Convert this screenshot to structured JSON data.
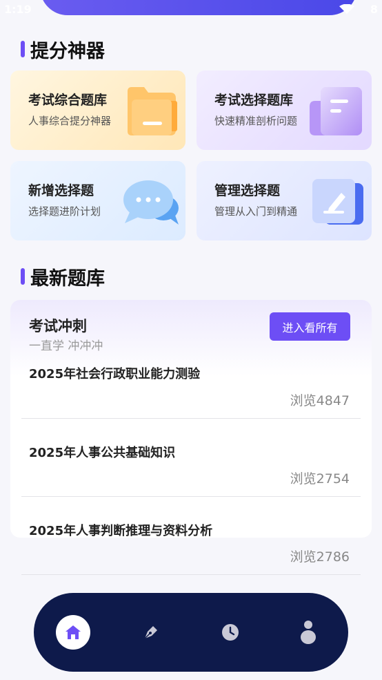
{
  "status": {
    "time": "1:19",
    "battery": "8"
  },
  "section1": {
    "title": "提分神器"
  },
  "cards": [
    {
      "title": "考试综合题库",
      "subtitle": "人事综合提分神器",
      "icon": "folder-icon",
      "accent": "#ffb84d"
    },
    {
      "title": "考试选择题库",
      "subtitle": "快速精准剖析问题",
      "icon": "document-icon",
      "accent": "#a07af5"
    },
    {
      "title": "新增选择题",
      "subtitle": "选择题进阶计划",
      "icon": "chat-bubble-icon",
      "accent": "#6fb7f5"
    },
    {
      "title": "管理选择题",
      "subtitle": "管理从入门到精通",
      "icon": "edit-note-icon",
      "accent": "#5b7bf5"
    }
  ],
  "section2": {
    "title": "最新题库"
  },
  "panel": {
    "title": "考试冲刺",
    "subtitle": "一直学 冲冲冲",
    "button": "进入看所有",
    "items": [
      {
        "title": "2025年社会行政职业能力测验",
        "views": "浏览4847"
      },
      {
        "title": "2025年人事公共基础知识",
        "views": "浏览2754"
      },
      {
        "title": "2025年人事判断推理与资料分析",
        "views": "浏览2786"
      }
    ]
  },
  "nav": [
    {
      "name": "home",
      "icon": "home-icon",
      "active": true
    },
    {
      "name": "practice",
      "icon": "pen-nib-icon",
      "active": false
    },
    {
      "name": "history",
      "icon": "clock-icon",
      "active": false
    },
    {
      "name": "profile",
      "icon": "user-icon",
      "active": false
    }
  ],
  "colors": {
    "accent": "#6d4ef5",
    "nav_bg": "#0e1a4b"
  }
}
